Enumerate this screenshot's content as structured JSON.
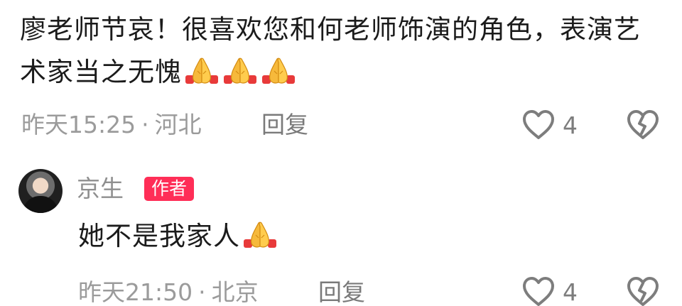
{
  "comments": [
    {
      "text": "廖老师节哀！很喜欢您和何老师饰演的角色，表演艺术家当之无愧",
      "emoji_name": "folded-hands-emoji",
      "emoji_count": 3,
      "time": "昨天15:25",
      "separator": "·",
      "location": "河北",
      "reply_label": "回复",
      "likes": "4"
    },
    {
      "author": "京生",
      "author_badge": "作者",
      "text": "她不是我家人",
      "emoji_name": "folded-hands-emoji",
      "emoji_count": 1,
      "time": "昨天21:50",
      "separator": "·",
      "location": "北京",
      "reply_label": "回复",
      "likes": "4"
    }
  ],
  "colors": {
    "text": "#1b1b1b",
    "meta": "#9b9b9b",
    "badge": "#ff2e57",
    "icon": "#7d7d7d"
  },
  "icons": [
    "heart-outline-icon",
    "broken-heart-icon",
    "folded-hands-emoji"
  ]
}
